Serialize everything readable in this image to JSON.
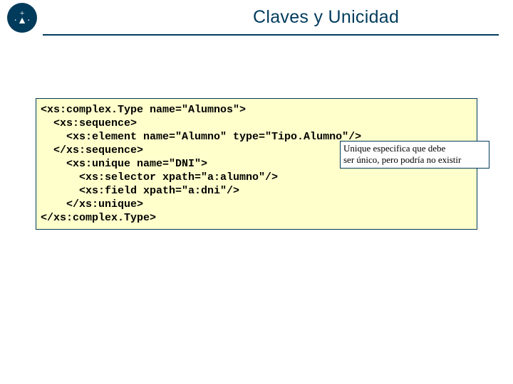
{
  "header": {
    "title": "Claves y Unicidad",
    "logo_top": "+",
    "logo_mid": "·▲·",
    "logo_bot": "⫀"
  },
  "code": {
    "l1": "<xs:complex.Type name=\"Alumnos\">",
    "l2": "  <xs:sequence>",
    "l3": "    <xs:element name=\"Alumno\" type=\"Tipo.Alumno\"/>",
    "l4": "  </xs:sequence>",
    "l5": "    <xs:unique name=\"DNI\">",
    "l6": "      <xs:selector xpath=\"a:alumno\"/>",
    "l7": "      <xs:field xpath=\"a:dni\"/>",
    "l8": "    </xs:unique>",
    "l9": "</xs:complex.Type>"
  },
  "callout": {
    "line1": "Unique especifica que debe",
    "line2": "ser único, pero podría no existir"
  }
}
